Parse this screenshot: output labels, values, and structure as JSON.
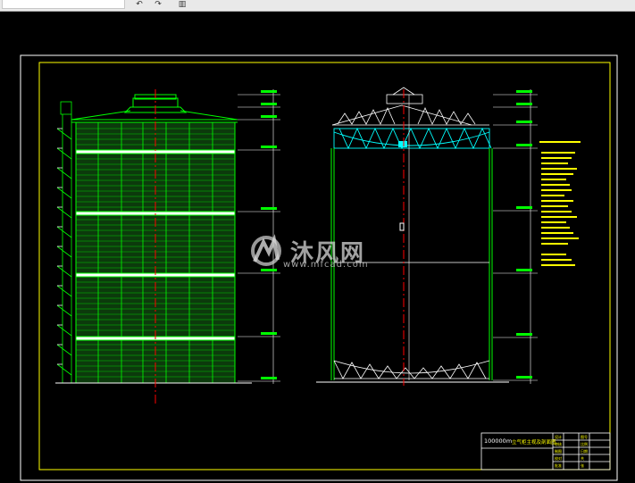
{
  "toolbar": {
    "field_value": "",
    "icons": [
      "undo-icon",
      "redo-icon",
      "delete-icon"
    ]
  },
  "watermark": {
    "brand": "沐风网",
    "site": "www.mfcad.com"
  },
  "title_block": {
    "capacity": "100000m",
    "drawing_name": "立气柜主视及剖面图",
    "cells": [
      "设计",
      "图号",
      "审核",
      "比例",
      "制图",
      "日期",
      "校对",
      "共",
      "批准",
      "张"
    ]
  },
  "colors": {
    "background": "#000000",
    "frame": "#ffff00",
    "structure": "#00ff00",
    "truss": "#00ffff",
    "centerline": "#ff0000",
    "annotation": "#ffffff"
  }
}
